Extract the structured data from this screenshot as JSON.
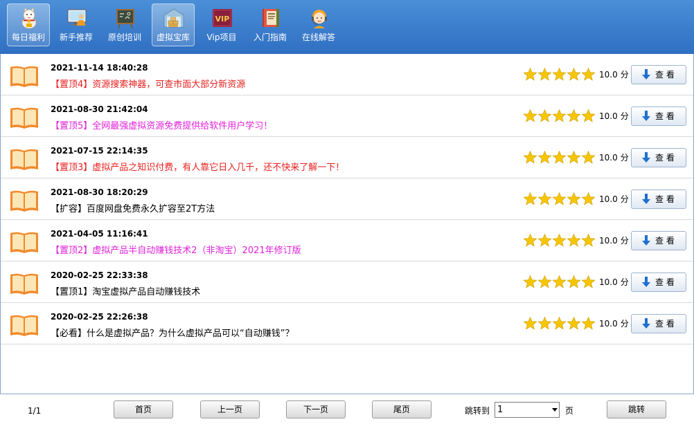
{
  "toolbar": {
    "items": [
      {
        "label": "每日福利",
        "icon": "lucky-cat-icon",
        "active": true
      },
      {
        "label": "新手推荐",
        "icon": "monitor-person-icon",
        "active": false
      },
      {
        "label": "原创培训",
        "icon": "chalkboard-icon",
        "active": false
      },
      {
        "label": "虚拟宝库",
        "icon": "warehouse-icon",
        "active": true
      },
      {
        "label": "Vip项目",
        "icon": "vip-badge-icon",
        "active": false
      },
      {
        "label": "入门指南",
        "icon": "guide-book-icon",
        "active": false
      },
      {
        "label": "在线解答",
        "icon": "support-agent-icon",
        "active": false
      }
    ]
  },
  "list": {
    "rating_unit": "分",
    "view_label": "查 看",
    "items": [
      {
        "date": "2021-11-14 18:40:28",
        "title": "【置顶4】资源搜索神器，可查市面大部分新资源",
        "color": "#e8201e",
        "rating": 5,
        "score": "10.0"
      },
      {
        "date": "2021-08-30 21:42:04",
        "title": "【置顶5】全网最强虚拟资源免费提供给软件用户学习！",
        "color": "#e020d8",
        "rating": 5,
        "score": "10.0"
      },
      {
        "date": "2021-07-15 22:14:35",
        "title": "【置顶3】虚拟产品之知识付费，有人靠它日入几千，还不快来了解一下！",
        "color": "#e8201e",
        "rating": 5,
        "score": "10.0"
      },
      {
        "date": "2021-08-30 18:20:29",
        "title": "【扩容】百度网盘免费永久扩容至2T方法",
        "color": "#000000",
        "rating": 5,
        "score": "10.0"
      },
      {
        "date": "2021-04-05 11:16:41",
        "title": "【置顶2】虚拟产品半自动赚钱技术2（非淘宝）2021年修订版",
        "color": "#e020d8",
        "rating": 5,
        "score": "10.0"
      },
      {
        "date": "2020-02-25 22:33:38",
        "title": "【置顶1】淘宝虚拟产品自动赚钱技术",
        "color": "#000000",
        "rating": 5,
        "score": "10.0"
      },
      {
        "date": "2020-02-25 22:26:38",
        "title": "【必看】什么是虚拟产品？为什么虚拟产品可以“自动赚钱”？",
        "color": "#000000",
        "rating": 5,
        "score": "10.0"
      }
    ]
  },
  "pager": {
    "page_info": "1/1",
    "first_label": "首页",
    "prev_label": "上一页",
    "next_label": "下一页",
    "last_label": "尾页",
    "jump_to_label": "跳转到",
    "page_value": "1",
    "page_unit": "页",
    "jump_label": "跳转"
  },
  "colors": {
    "toolbar_top": "#4a8fd8",
    "toolbar_bottom": "#2f6fc2",
    "star": "#f7c600",
    "book": "#f08a2c",
    "arrow": "#1e6fd0"
  }
}
